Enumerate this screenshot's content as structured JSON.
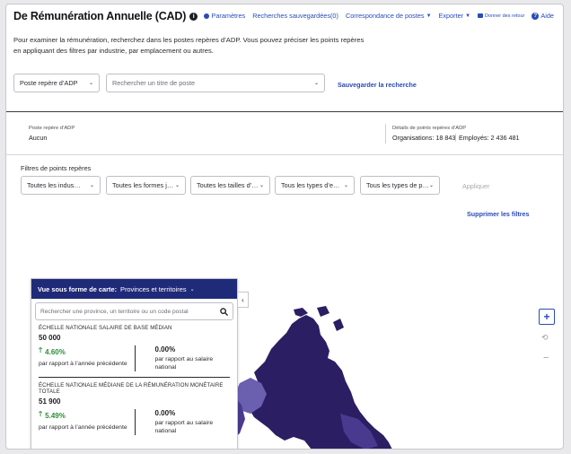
{
  "header": {
    "title": "De Rémunération Annuelle (CAD)",
    "nav": {
      "params": "Paramètres",
      "saved": "Recherches sauvegardées(0)",
      "match": "Correspondance de postes",
      "export": "Exporter",
      "feedback": "Donner des retour",
      "help": "Aide"
    }
  },
  "intro": "Pour examiner la rémunération, recherchez dans les postes repères d’ADP. Vous pouvez préciser les points repères en appliquant des filtres par industrie, par emplacement ou autres.",
  "search": {
    "benchmark_select": "Poste repère d’ADP",
    "title_placeholder": "Rechercher un titre de poste",
    "save_link": "Sauvegarder la recherche"
  },
  "details": {
    "benchmark_label": "Poste repère d’ADP",
    "benchmark_value": "Aucun",
    "points_label": "Détails de points repères d’ADP",
    "organisations": "Organisations: 18 843",
    "employees": "Employés: 2 436 481"
  },
  "filters": {
    "label": "Filtres de points repères",
    "industries": "Toutes les indus…",
    "forms": "Toutes les formes j…",
    "sizes": "Toutes les tailles d’…",
    "types1": "Tous les types d’e…",
    "types2": "Tous les types de p…",
    "apply": "Appliquer",
    "clear": "Supprimer les filtres"
  },
  "panel": {
    "view_label": "Vue sous forme de carte:",
    "view_value": "Provinces et territoires",
    "search_placeholder": "Rechercher une province, un territoire ou un code postal",
    "stat1": {
      "title": "ÉCHELLE NATIONALE SALAIRE DE BASE MÉDIAN",
      "value": "50 000",
      "pct_prev": "4.60%",
      "note_prev": "par rapport à l’année précédente",
      "pct_nat": "0.00%",
      "note_nat": "par rapport au salaire national"
    },
    "stat2": {
      "title": "ÉCHELLE NATIONALE MÉDIANE DE LA RÉMUNÉRATION MONÉTAIRE TOTALE",
      "value": "51 900",
      "pct_prev": "5.49%",
      "note_prev": "par rapport à l’année précédente",
      "pct_nat": "0.00%",
      "note_nat": "par rapport au salaire national"
    }
  },
  "colors": {
    "accent": "#2a4bb8",
    "panel_header": "#1f2b78",
    "map_dark": "#2c1e63",
    "map_mid": "#4a3a8f",
    "map_light": "#6b5fb0",
    "positive": "#2e8b3a"
  },
  "icons": {
    "info": "info-icon",
    "gear": "gear-icon",
    "chevron": "chevron-down-icon",
    "search": "search-icon",
    "arrow_up": "arrow-up-icon",
    "plus": "plus-icon",
    "reset": "reset-icon",
    "minus": "minus-icon"
  }
}
